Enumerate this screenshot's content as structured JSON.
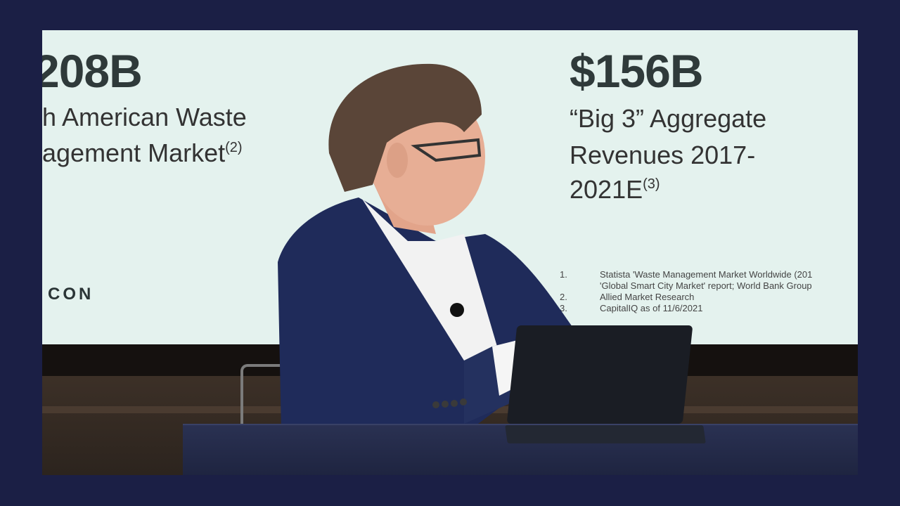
{
  "slide": {
    "left_stat": {
      "value": "208B",
      "line1": "h American Waste",
      "line2": "agement Market",
      "ref": "(2)"
    },
    "right_stat": {
      "value": "$156B",
      "line1": "“Big 3” Aggregate",
      "line2": "Revenues 2017-",
      "line3": "2021E",
      "ref": "(3)"
    },
    "logo_text": "CON",
    "footnotes": [
      {
        "num": "1.",
        "text": "Statista 'Waste Management Market Worldwide (201"
      },
      {
        "num": "",
        "text": "'Global Smart City Market' report; World Bank Group"
      },
      {
        "num": "2.",
        "text": "Allied Market Research"
      },
      {
        "num": "3.",
        "text": "CapitalIQ as of 11/6/2021"
      }
    ]
  },
  "colors": {
    "border": "#1b1f45",
    "slide_bg": "#e4f2ee",
    "jacket": "#1f2b5a",
    "table": "#2a3152"
  }
}
